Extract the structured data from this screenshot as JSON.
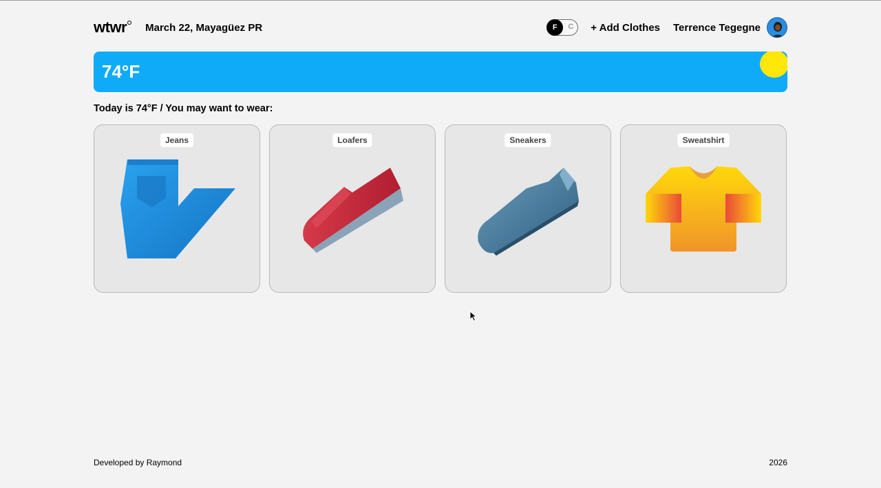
{
  "header": {
    "logo": "wtwr",
    "date_location": "March 22, Mayagüez PR",
    "toggle": {
      "active": "F",
      "inactive": "C"
    },
    "add_clothes_label": "+ Add Clothes",
    "username": "Terrence Tegegne"
  },
  "weather": {
    "temperature": "74°F",
    "condition_icon": "sun-icon"
  },
  "suggestion_text": "Today is 74°F / You may want to wear:",
  "items": [
    {
      "label": "Jeans",
      "icon": "jeans-icon",
      "color": "#1a8fe0"
    },
    {
      "label": "Loafers",
      "icon": "loafers-icon",
      "color": "#c0283a"
    },
    {
      "label": "Sneakers",
      "icon": "sneakers-icon",
      "color": "#4a7fa0"
    },
    {
      "label": "Sweatshirt",
      "icon": "sweatshirt-icon",
      "color": "#f5b21e"
    }
  ],
  "footer": {
    "developer": "Developed by Raymond",
    "year": "2026"
  },
  "colors": {
    "weather_banner": "#0fabf8",
    "sun": "#ffe70a",
    "background": "#f3f3f3",
    "card": "#e7e7e7"
  }
}
